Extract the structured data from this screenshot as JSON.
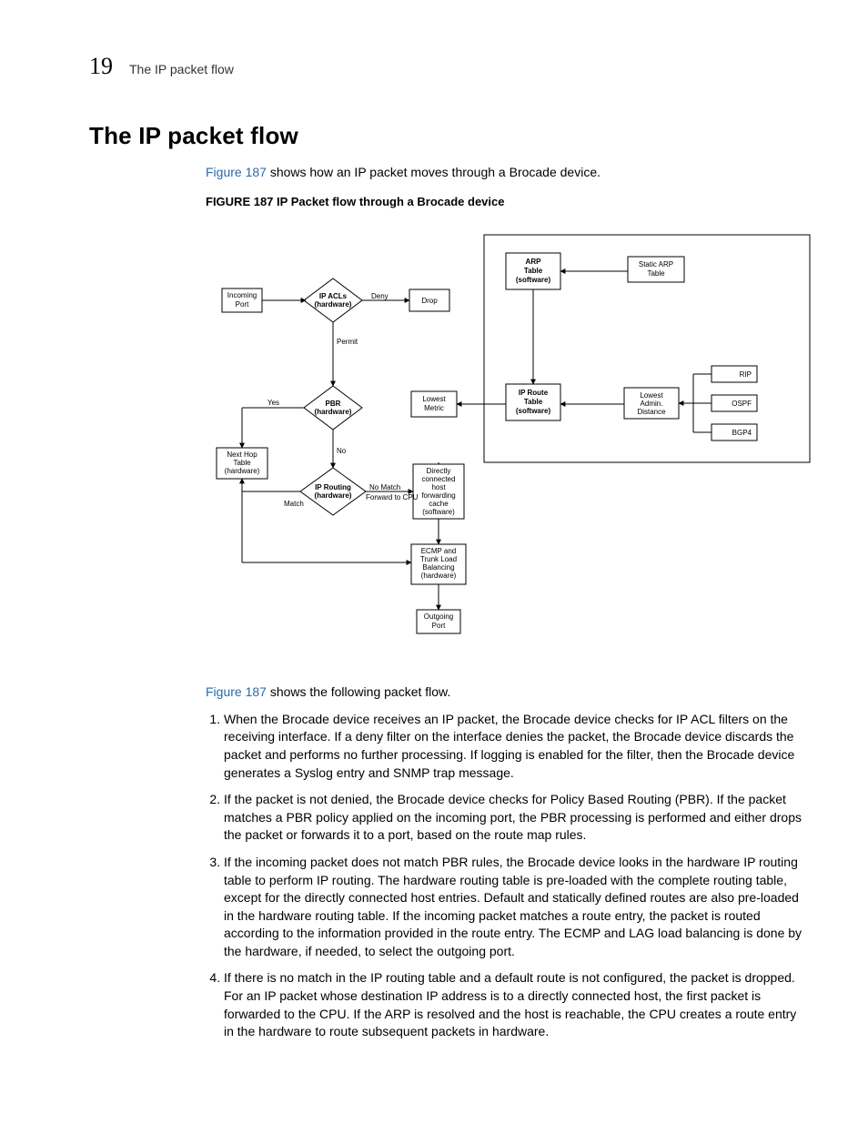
{
  "chapter_number": "19",
  "header_title": "The IP packet flow",
  "main_heading": "The IP packet flow",
  "figure_ref_text": "Figure 187",
  "intro_para_tail": " shows how an IP packet moves through a Brocade device.",
  "figure_label": "FIGURE 187",
  "figure_caption_tail": "   IP Packet flow through a Brocade device",
  "second_para_tail": " shows the following packet flow.",
  "steps": {
    "1": "When the Brocade device receives an IP packet, the Brocade device checks for IP ACL filters on the receiving interface. If a deny filter on the interface denies the packet, the Brocade device discards the packet and performs no further processing. If logging is enabled for the filter, then the Brocade device generates a Syslog entry and SNMP trap message.",
    "2": "If the packet is not denied, the Brocade device checks for Policy Based Routing (PBR). If the packet matches a PBR policy applied on the incoming port, the PBR processing is performed and either drops the packet or forwards it to a port, based on the route map rules.",
    "3": "If the incoming packet does not match PBR rules, the Brocade device looks in the hardware IP routing table to perform IP routing. The hardware routing table is pre-loaded with the complete routing table, except for the directly connected host entries. Default and statically defined routes are also pre-loaded in the hardware routing table. If the incoming packet matches a route entry, the packet is routed according to the information provided in the route entry. The ECMP and LAG load balancing is done by the hardware, if needed, to select the outgoing port.",
    "4": "If there is no match in the IP routing table and a default route is not configured, the packet is dropped. For an IP packet whose destination IP address is to a directly connected host, the first packet is forwarded to the CPU. If the ARP is resolved and the host is reachable, the CPU creates a route entry in the hardware to route subsequent packets in hardware."
  },
  "diagram": {
    "incoming_port": "Incoming\nPort",
    "ip_acls": "IP ACLs\n(hardware)",
    "deny": "Deny",
    "permit": "Permit",
    "drop": "Drop",
    "pbr": "PBR\n(hardware)",
    "yes": "Yes",
    "no": "No",
    "next_hop": "Next Hop\nTable\n(hardware)",
    "ip_routing": "IP Routing\n(hardware)",
    "match": "Match",
    "no_match": "No Match\nForward to CPU",
    "dchfc": "Directly\nconnected\nhost\nforwarding\ncache\n(software)",
    "ecmp": "ECMP and\nTrunk Load\nBalancing\n(hardware)",
    "outgoing": "Outgoing\nPort",
    "lowest_metric": "Lowest\nMetric",
    "ip_route_table": "IP Route\nTable\n(software)",
    "arp_table": "ARP\nTable\n(software)",
    "static_arp": "Static ARP\nTable",
    "lowest_admin": "Lowest\nAdmin.\nDistance",
    "rip": "RIP",
    "ospf": "OSPF",
    "bgp4": "BGP4"
  }
}
